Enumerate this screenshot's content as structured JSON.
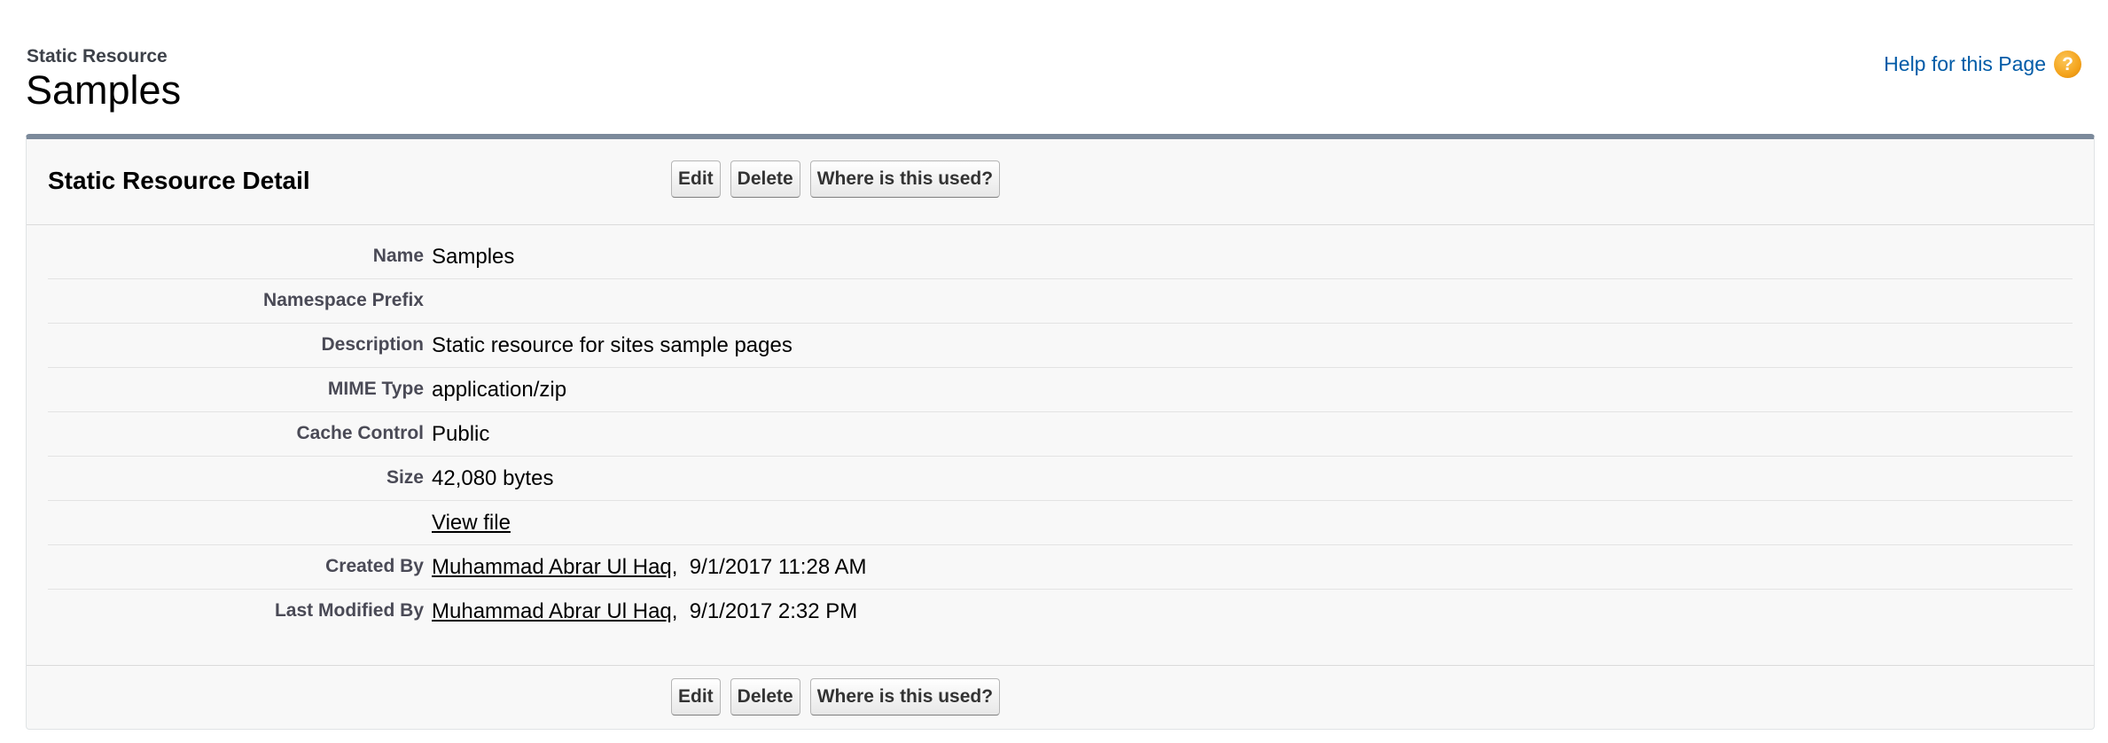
{
  "page": {
    "type_label": "Static Resource",
    "title": "Samples",
    "help_link": "Help for this Page",
    "help_icon": "?"
  },
  "detail": {
    "title": "Static Resource Detail",
    "buttons": {
      "edit": "Edit",
      "delete": "Delete",
      "where_used": "Where is this used?"
    },
    "fields": {
      "name": {
        "label": "Name",
        "value": "Samples"
      },
      "namespace_prefix": {
        "label": "Namespace Prefix",
        "value": ""
      },
      "description": {
        "label": "Description",
        "value": "Static resource for sites sample pages"
      },
      "mime_type": {
        "label": "MIME Type",
        "value": "application/zip"
      },
      "cache_control": {
        "label": "Cache Control",
        "value": "Public"
      },
      "size": {
        "label": "Size",
        "value": "42,080 bytes"
      },
      "view_file": {
        "label": "",
        "link": "View file"
      },
      "created_by": {
        "label": "Created By",
        "user": "Muhammad Abrar Ul Haq",
        "separator": ",",
        "date": "9/1/2017 11:28 AM"
      },
      "last_modified_by": {
        "label": "Last Modified By",
        "user": "Muhammad Abrar Ul Haq",
        "separator": ",",
        "date": "9/1/2017 2:32 PM"
      }
    }
  },
  "colors": {
    "link_blue": "#015ba7",
    "panel_top_border": "#7c8a9b",
    "panel_background": "#f8f8f8",
    "label_text": "#4a4a56",
    "help_icon": "#f4a31b"
  }
}
